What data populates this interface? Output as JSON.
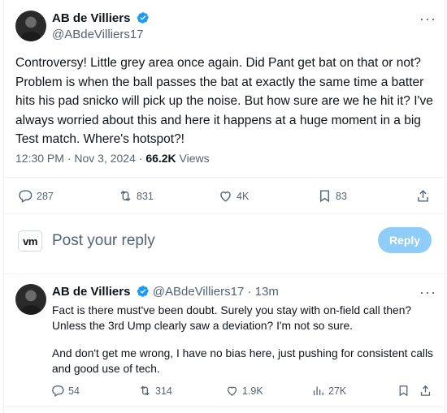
{
  "tweet": {
    "author_name": "AB de Villiers",
    "author_handle": "@ABdeVilliers17",
    "more": "···",
    "text": "Controversy! Little grey area once again. Did Pant get bat on that or not? Problem is when the ball passes the bat at exactly the same time a batter hits his pad snicko will pick up the noise. But how sure are we he hit it? I've always worried about this and here it happens at a huge moment in a big Test match. Where's hotspot?!",
    "timestamp": "12:30 PM · Nov 3, 2024 · ",
    "views_count": "66.2K",
    "views_label": " Views",
    "actions": {
      "replies": "287",
      "reposts": "831",
      "likes": "4K",
      "bookmarks": "83"
    }
  },
  "composer": {
    "logo_text": "vm",
    "placeholder": "Post your reply",
    "reply_button": "Reply"
  },
  "reply_tweet": {
    "author_name": "AB de Villiers",
    "author_handle": "@ABdeVilliers17",
    "age": "· 13m",
    "more": "···",
    "paragraph1": "Fact is there must've been doubt. Surely you stay with on-field call then? Unless the 3rd Ump clearly saw a deviation? I'm not so sure.",
    "paragraph2": "And don't get me wrong, I have no bias here, just pushing for consistent calls and good use of tech.",
    "actions": {
      "replies": "54",
      "reposts": "314",
      "likes": "1.9K",
      "views": "27K"
    }
  },
  "colors": {
    "accent": "#1d9bf0",
    "muted": "#536471",
    "reply_button_disabled": "#8ecdf7"
  }
}
